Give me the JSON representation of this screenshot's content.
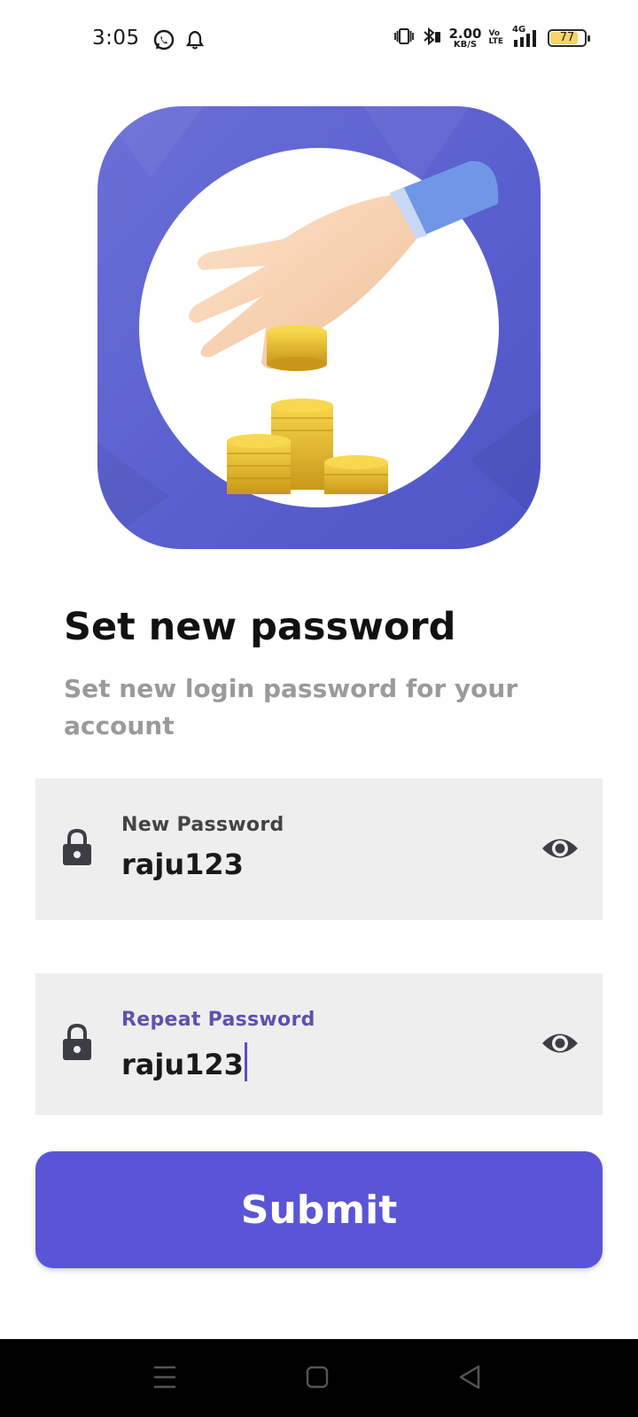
{
  "status_bar": {
    "time": "3:05",
    "net_speed_value": "2.00",
    "net_speed_unit": "KB/S",
    "volte_top": "Vo",
    "volte_bottom": "LTE",
    "network": "4G",
    "battery_level": "77"
  },
  "icons": {
    "whatsapp": "whatsapp-icon",
    "notification": "bell-icon",
    "vibrate": "vibrate-icon",
    "bluetooth": "bluetooth-icon",
    "signal": "signal-icon",
    "battery": "battery-icon",
    "lock": "lock-icon",
    "visibility": "eye-icon",
    "nav_menu": "menu-icon",
    "nav_home": "square-icon",
    "nav_back": "back-triangle-icon"
  },
  "colors": {
    "primary": "#5a55d6",
    "hero_bg": "#5a5fcf",
    "field_bg": "#eeeeee",
    "active_label": "#6050b0"
  },
  "heading": {
    "title": "Set new password",
    "subtitle": "Set new login password for your account"
  },
  "form": {
    "new_password": {
      "label": "New Password",
      "value": "raju123"
    },
    "repeat_password": {
      "label": "Repeat Password",
      "value": "raju123"
    },
    "submit_label": "Submit"
  }
}
